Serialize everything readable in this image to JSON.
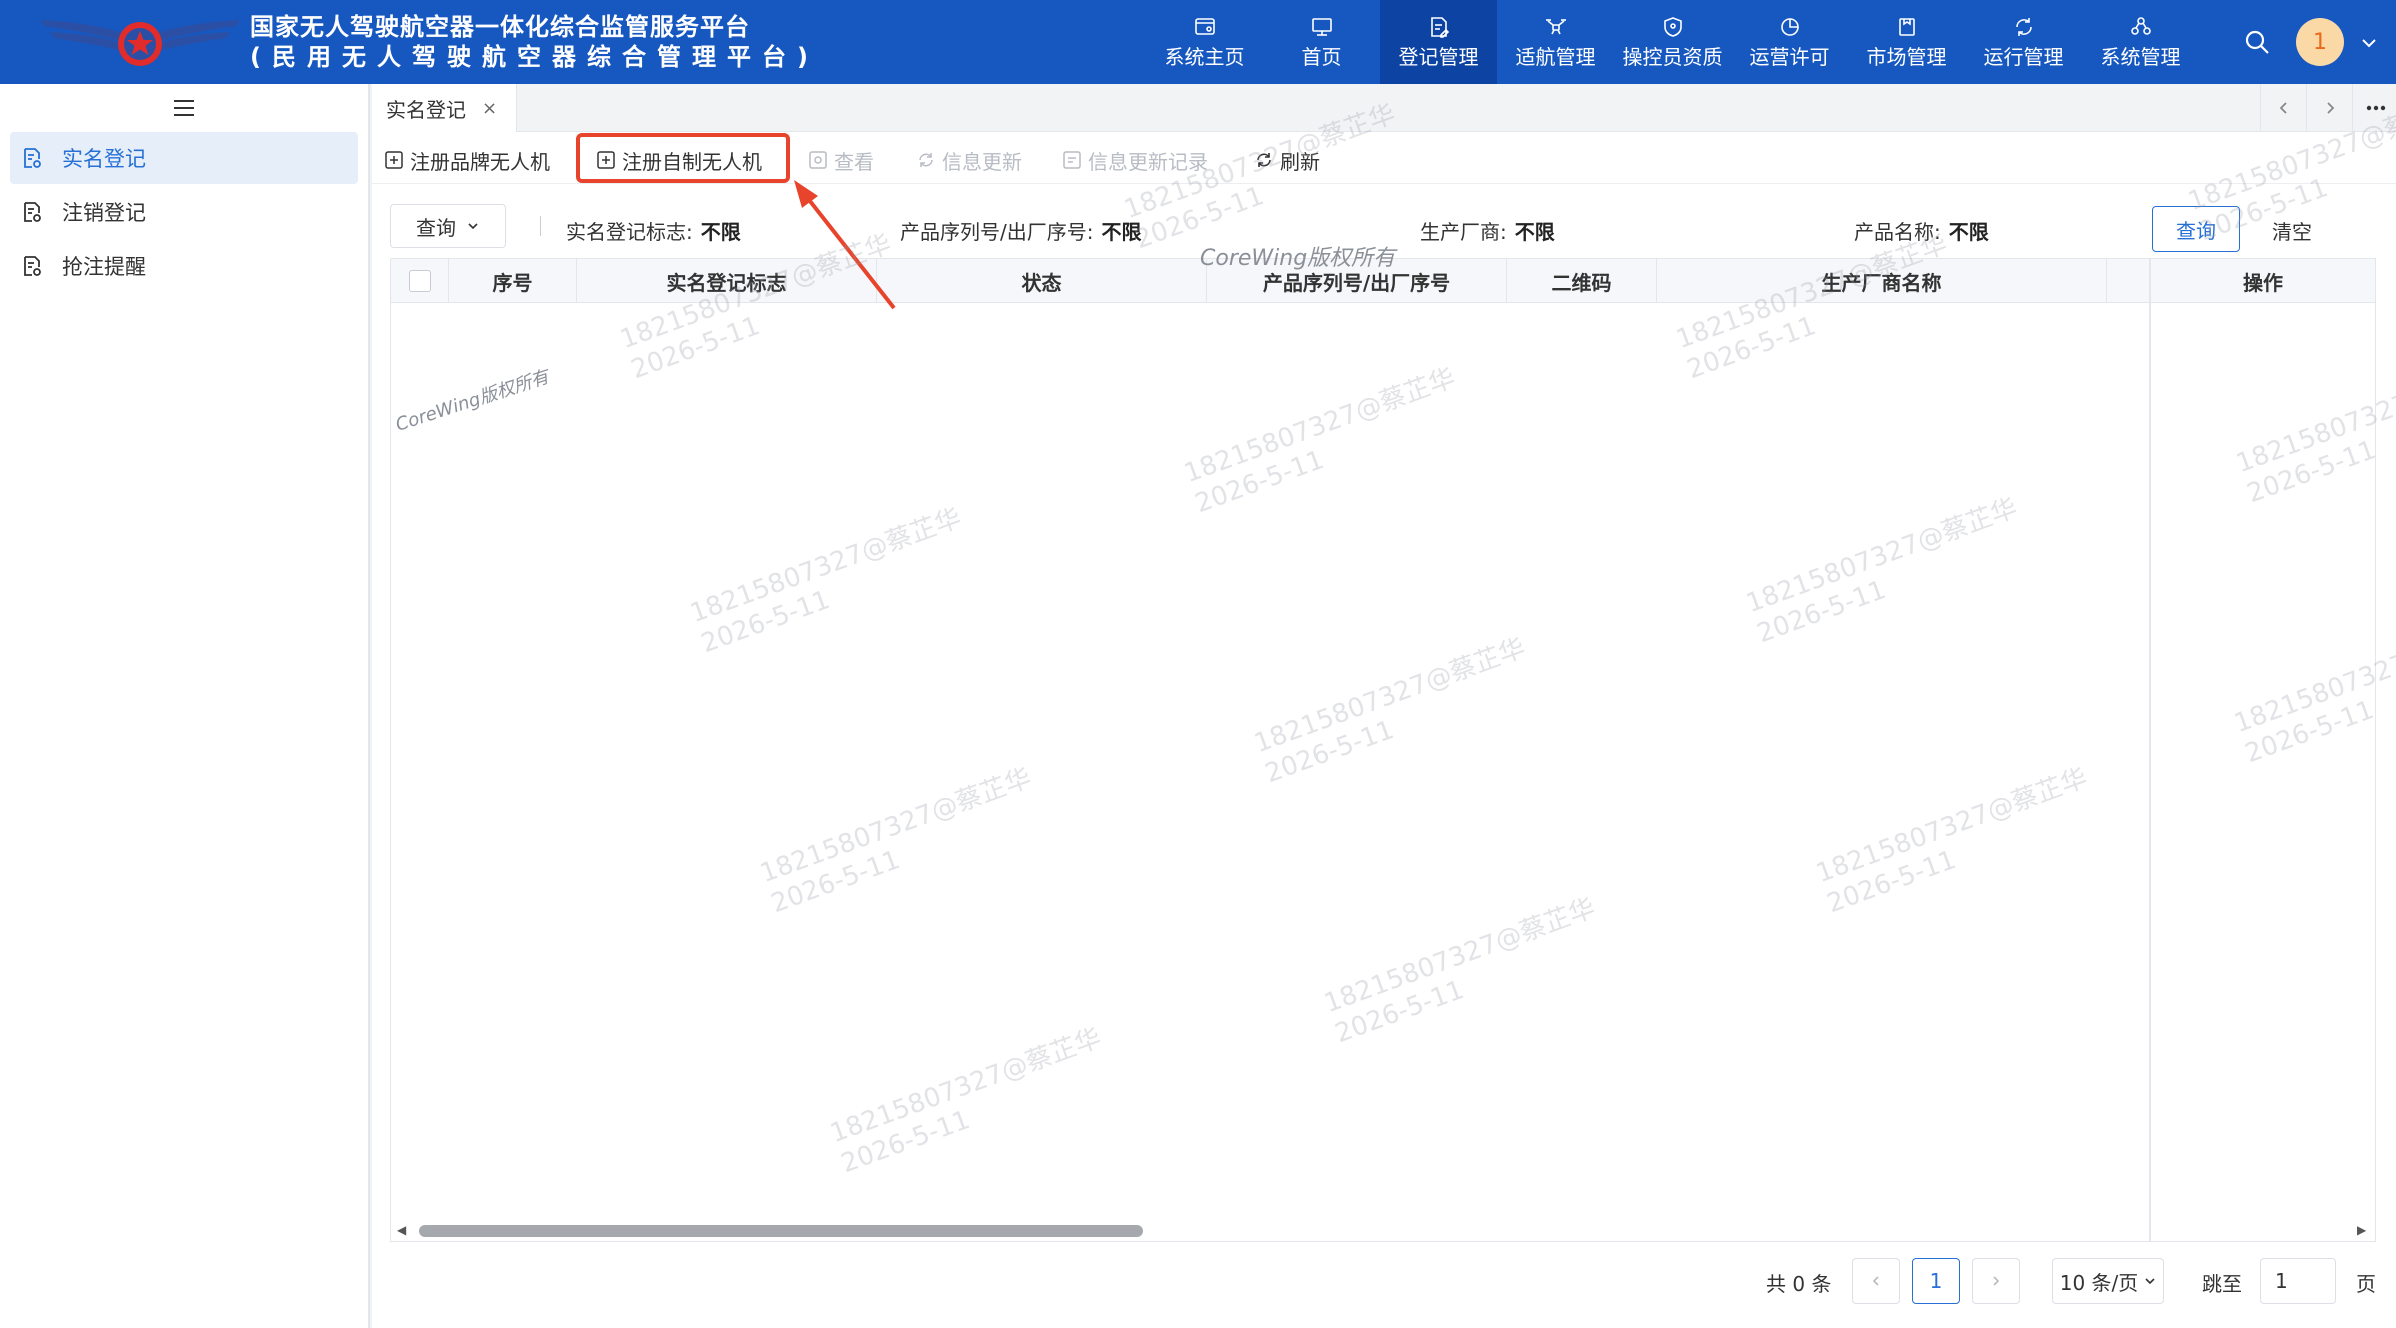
{
  "header": {
    "title_line1": "国家无人驾驶航空器一体化综合监管服务平台",
    "title_line2": "(民用无人驾驶航空器综合管理平台)",
    "nav": [
      {
        "label": "系统主页",
        "icon": "window-icon"
      },
      {
        "label": "首页",
        "icon": "monitor-icon"
      },
      {
        "label": "登记管理",
        "icon": "register-doc-icon",
        "active": true
      },
      {
        "label": "适航管理",
        "icon": "drone-icon"
      },
      {
        "label": "操控员资质",
        "icon": "shield-icon"
      },
      {
        "label": "运营许可",
        "icon": "chart-pie-icon"
      },
      {
        "label": "市场管理",
        "icon": "market-icon"
      },
      {
        "label": "运行管理",
        "icon": "cycle-icon"
      },
      {
        "label": "系统管理",
        "icon": "system-icon"
      }
    ],
    "avatar_text": "1"
  },
  "sidebar": {
    "items": [
      {
        "label": "实名登记",
        "active": true
      },
      {
        "label": "注销登记"
      },
      {
        "label": "抢注提醒"
      }
    ]
  },
  "tabs": [
    {
      "label": "实名登记",
      "close": "×"
    }
  ],
  "toolbar": {
    "buttons": [
      {
        "label": "注册品牌无人机",
        "enabled": true
      },
      {
        "label": "注册自制无人机",
        "enabled": true
      },
      {
        "label": "查看",
        "enabled": false
      },
      {
        "label": "信息更新",
        "enabled": false
      },
      {
        "label": "信息更新记录",
        "enabled": false
      },
      {
        "label": "刷新",
        "enabled": true
      }
    ]
  },
  "filter": {
    "query_label": "查询",
    "fields": [
      {
        "label": "实名登记标志:",
        "value": "不限"
      },
      {
        "label": "产品序列号/出厂序号:",
        "value": "不限"
      },
      {
        "label": "生产厂商:",
        "value": "不限"
      },
      {
        "label": "产品名称:",
        "value": "不限"
      }
    ],
    "query_button": "查询",
    "clear_button": "清空"
  },
  "table": {
    "columns": [
      "序号",
      "实名登记标志",
      "状态",
      "产品序列号/出厂序号",
      "二维码",
      "生产厂商名称",
      "操作"
    ],
    "rows": []
  },
  "pagination": {
    "total": "共 0 条",
    "current_page": "1",
    "page_size": "10 条/页",
    "jump_label": "跳至",
    "jump_value": "1",
    "page_suffix": "页"
  },
  "watermark": {
    "brand": "CoreWing版权所有",
    "user": "18215807327@蔡芷华",
    "date": "2026-5-11"
  },
  "colors": {
    "header_bg": "#1658c0",
    "active_nav": "#0d44a4",
    "accent": "#2670d6",
    "highlight": "#e8432b"
  }
}
